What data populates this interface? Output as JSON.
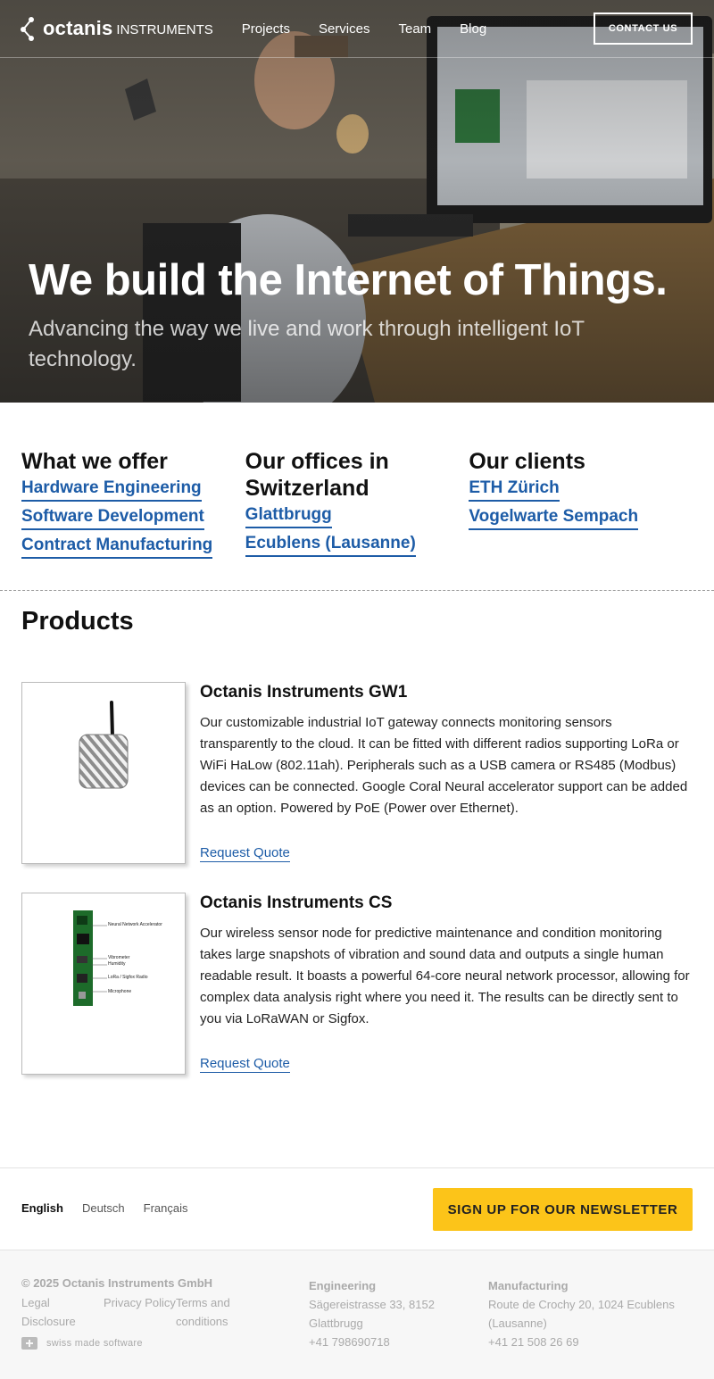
{
  "brand": {
    "name": "octanis",
    "sub": "INSTRUMENTS"
  },
  "nav": {
    "items": [
      "Projects",
      "Services",
      "Team",
      "Blog"
    ],
    "contact": "CONTACT US"
  },
  "hero": {
    "title": "We build the Internet of Things.",
    "subtitle": "Advancing the way we live and work through intelligent IoT technology."
  },
  "columns": [
    {
      "heading": "What we offer",
      "links": [
        "Hardware Engineering",
        "Software Development",
        "Contract Manufacturing"
      ]
    },
    {
      "heading": "Our offices in Switzerland",
      "links": [
        "Glattbrugg",
        "Ecublens (Lausanne)"
      ]
    },
    {
      "heading": "Our clients",
      "links": [
        "ETH Zürich",
        "Vogelwarte Sempach"
      ]
    }
  ],
  "products": {
    "title": "Products",
    "items": [
      {
        "name": "Octanis Instruments GW1",
        "description": "Our customizable industrial IoT gateway connects monitoring sensors transparently to the cloud. It can be fitted with different radios supporting LoRa or WiFi HaLow (802.11ah). Peripherals such as a USB camera or RS485 (Modbus) devices can be connected. Google Coral Neural accelerator support can be added as an option. Powered by PoE (Power over Ethernet).",
        "cta": "Request Quote"
      },
      {
        "name": "Octanis Instruments CS",
        "description": "Our wireless sensor node for predictive maintenance and condition monitoring takes large snapshots of vibration and sound data and outputs a single human readable result. It boasts a powerful 64-core neural network processor, allowing for complex data analysis right where you need it. The results can be directly sent to you via LoRaWAN or Sigfox.",
        "cta": "Request Quote",
        "callouts": [
          "Neural Network Accelerator",
          "Vibrometer",
          "Humidity",
          "LoRa / Sigfox Radio",
          "Microphone"
        ]
      }
    ]
  },
  "languages": [
    "English",
    "Deutsch",
    "Français"
  ],
  "newsletter": "SIGN UP FOR OUR NEWSLETTER",
  "footer": {
    "copyright": "© 2025 Octanis Instruments GmbH",
    "links": [
      "Legal Disclosure",
      "Privacy Policy",
      "Terms and conditions"
    ],
    "swiss": "swiss made software",
    "engineering": {
      "title": "Engineering",
      "address": "Sägereistrasse 33, 8152 Glattbrugg",
      "phone": "+41 798690718"
    },
    "manufacturing": {
      "title": "Manufacturing",
      "address": "Route de Crochy 20, 1024 Ecublens (Lausanne)",
      "phone": "+41 21 508 26 69"
    }
  }
}
